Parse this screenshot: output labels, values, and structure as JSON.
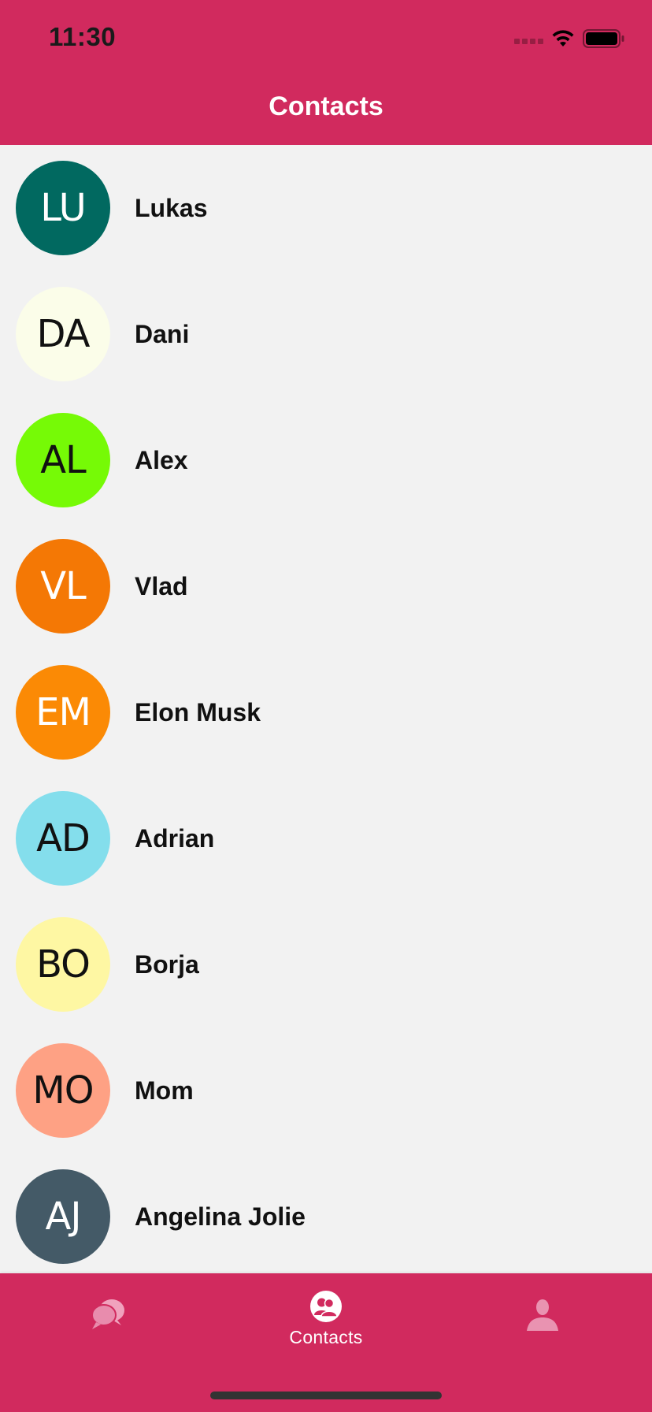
{
  "status_bar": {
    "time": "11:30"
  },
  "header": {
    "title": "Contacts"
  },
  "contacts": [
    {
      "initials": "LU",
      "name": "Lukas",
      "avatar_bg": "#016960",
      "avatar_fg": "#ffffff"
    },
    {
      "initials": "DA",
      "name": "Dani",
      "avatar_bg": "#fbfde9",
      "avatar_fg": "#111111"
    },
    {
      "initials": "AL",
      "name": "Alex",
      "avatar_bg": "#76fa06",
      "avatar_fg": "#111111"
    },
    {
      "initials": "VL",
      "name": "Vlad",
      "avatar_bg": "#f47805",
      "avatar_fg": "#ffffff"
    },
    {
      "initials": "EM",
      "name": "Elon Musk",
      "avatar_bg": "#fb8a05",
      "avatar_fg": "#ffffff"
    },
    {
      "initials": "AD",
      "name": "Adrian",
      "avatar_bg": "#84deec",
      "avatar_fg": "#111111"
    },
    {
      "initials": "BO",
      "name": "Borja",
      "avatar_bg": "#fef7a3",
      "avatar_fg": "#111111"
    },
    {
      "initials": "MO",
      "name": "Mom",
      "avatar_bg": "#fea184",
      "avatar_fg": "#111111"
    },
    {
      "initials": "AJ",
      "name": "Angelina Jolie",
      "avatar_bg": "#445a67",
      "avatar_fg": "#ffffff"
    }
  ],
  "tab_bar": {
    "tabs": [
      {
        "icon": "chat-bubbles-icon",
        "label": "",
        "active": false
      },
      {
        "icon": "contacts-icon",
        "label": "Contacts",
        "active": true
      },
      {
        "icon": "profile-icon",
        "label": "",
        "active": false
      }
    ]
  },
  "colors": {
    "brand": "#d12a5e",
    "list_background": "#f2f2f2",
    "inactive_icon": "#e993b1"
  }
}
